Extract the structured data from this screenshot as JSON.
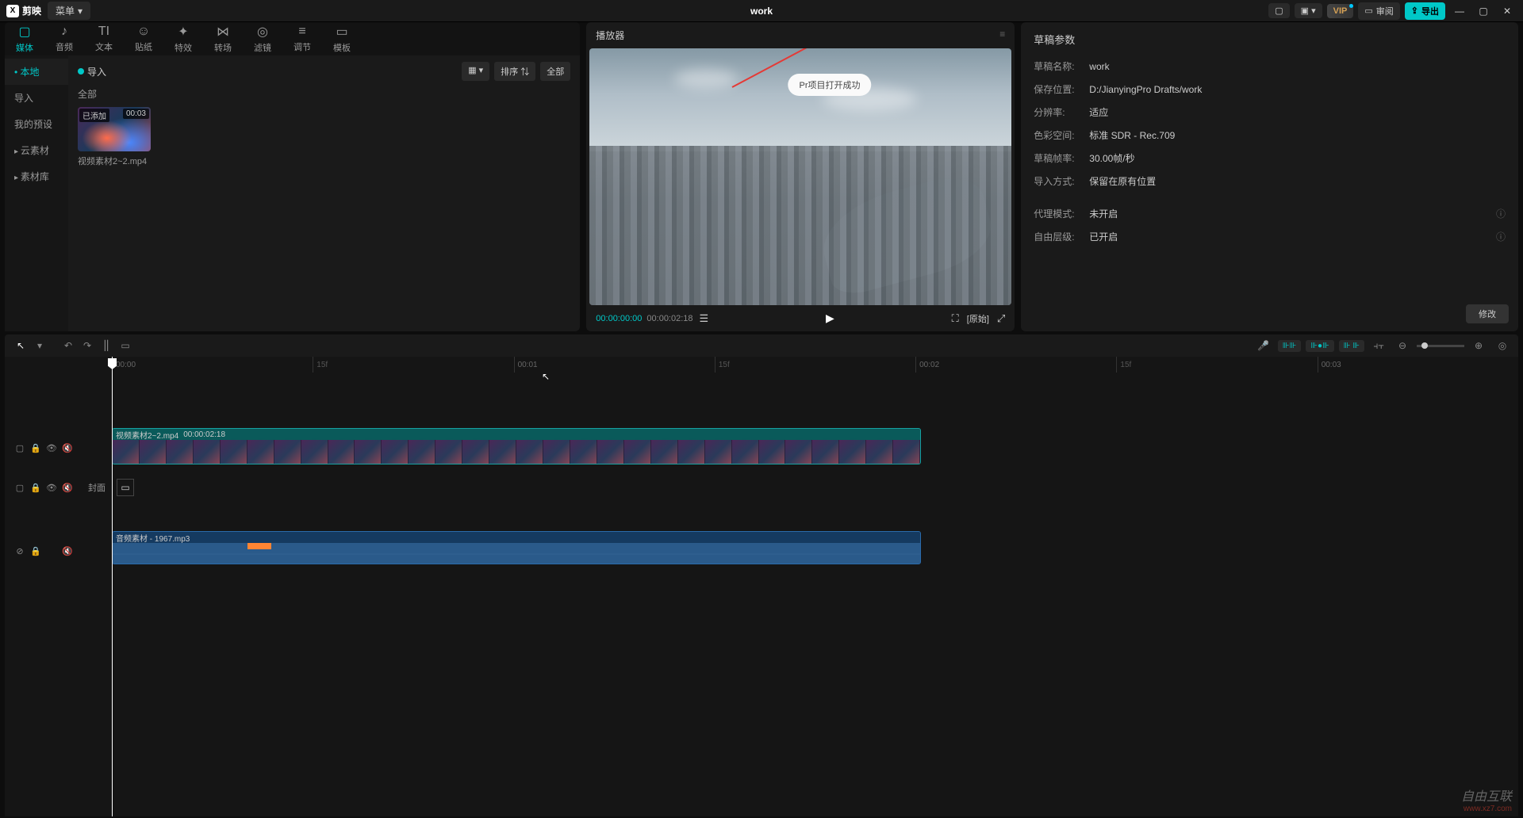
{
  "titlebar": {
    "app_name": "剪映",
    "menu_label": "菜单",
    "project_title": "work",
    "vip_label": "VIP",
    "review_label": "审阅",
    "export_label": "导出"
  },
  "tabs": [
    {
      "label": "媒体",
      "icon": "▢"
    },
    {
      "label": "音频",
      "icon": "♪"
    },
    {
      "label": "文本",
      "icon": "TI"
    },
    {
      "label": "贴纸",
      "icon": "☺"
    },
    {
      "label": "特效",
      "icon": "✦"
    },
    {
      "label": "转场",
      "icon": "⋈"
    },
    {
      "label": "滤镜",
      "icon": "◎"
    },
    {
      "label": "调节",
      "icon": "≡"
    },
    {
      "label": "模板",
      "icon": "▭"
    }
  ],
  "sidebar": {
    "items": [
      {
        "label": "本地",
        "active": true
      },
      {
        "label": "导入"
      },
      {
        "label": "我的预设"
      },
      {
        "label": "云素材",
        "arrow": true
      },
      {
        "label": "素材库",
        "arrow": true
      }
    ]
  },
  "media": {
    "import_label": "导入",
    "sort_label": "排序",
    "all_btn": "全部",
    "section_label": "全部",
    "clip": {
      "badge": "已添加",
      "duration": "00:03",
      "name": "视频素材2~2.mp4"
    }
  },
  "player": {
    "title": "播放器",
    "tooltip": "Pr项目打开成功",
    "current_time": "00:00:00:00",
    "duration": "00:00:02:18",
    "ratio_label": "[原始]"
  },
  "params": {
    "title": "草稿参数",
    "rows": [
      {
        "label": "草稿名称:",
        "value": "work"
      },
      {
        "label": "保存位置:",
        "value": "D:/JianyingPro Drafts/work"
      },
      {
        "label": "分辨率:",
        "value": "适应"
      },
      {
        "label": "色彩空间:",
        "value": "标准 SDR - Rec.709"
      },
      {
        "label": "草稿帧率:",
        "value": "30.00帧/秒"
      },
      {
        "label": "导入方式:",
        "value": "保留在原有位置"
      },
      {
        "label": "代理模式:",
        "value": "未开启"
      },
      {
        "label": "自由层级:",
        "value": "已开启"
      }
    ],
    "modify_btn": "修改"
  },
  "timeline": {
    "ruler": [
      "00:00",
      "15f",
      "00:01",
      "15f",
      "00:02",
      "15f",
      "00:03"
    ],
    "video_clip": {
      "name": "视频素材2~2.mp4",
      "time": "00:00:02:18"
    },
    "cover_label": "封面",
    "audio_clip": {
      "name": "音频素材 - 1967.mp3"
    }
  },
  "watermark": {
    "brand": "自由互联",
    "url": "www.xz7.com"
  }
}
